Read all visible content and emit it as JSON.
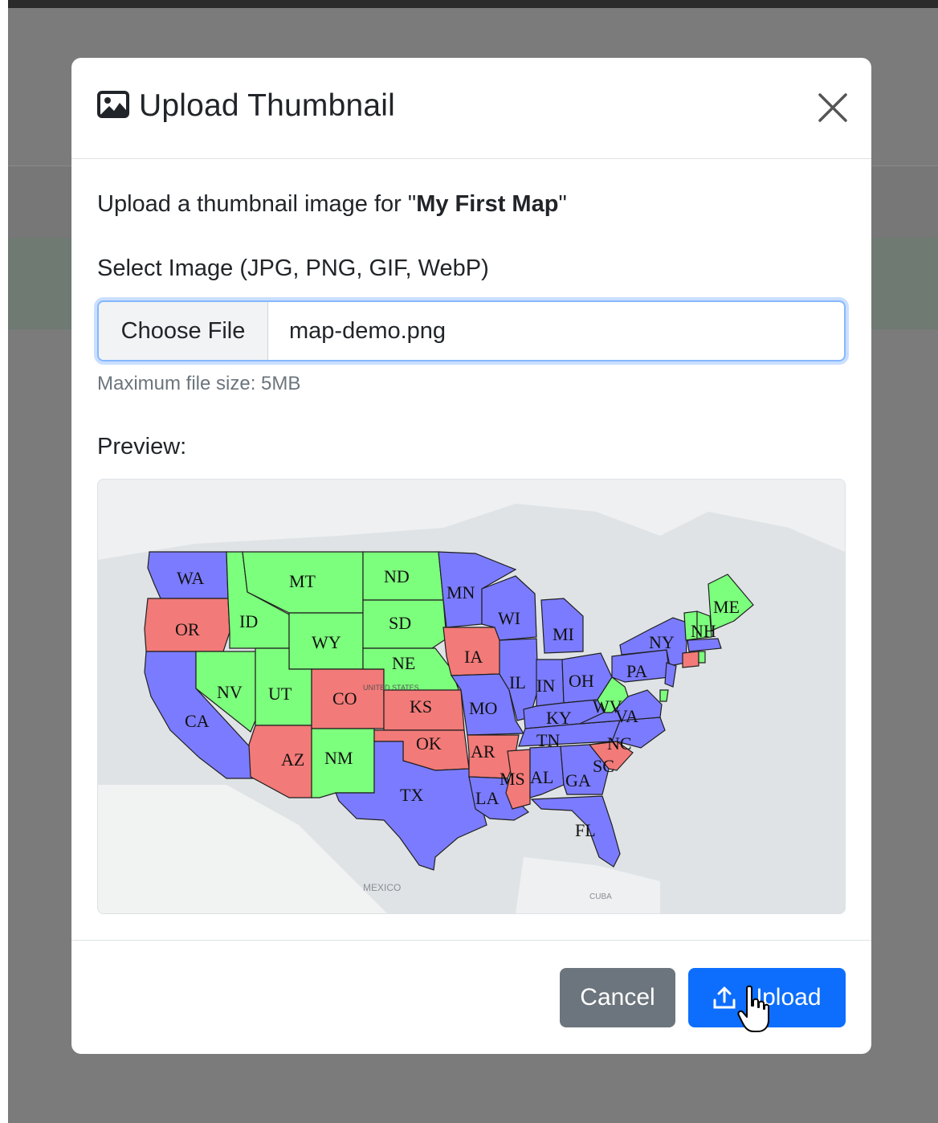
{
  "modal": {
    "title": "Upload Thumbnail",
    "close_icon": "close-icon",
    "description_prefix": "Upload a thumbnail image for \"",
    "map_name": "My First Map",
    "description_suffix": "\"",
    "select_label": "Select Image (JPG, PNG, GIF, WebP)",
    "choose_file_label": "Choose File",
    "file_name": "map-demo.png",
    "help_text": "Maximum file size: 5MB",
    "preview_label": "Preview:",
    "cancel_label": "Cancel",
    "upload_label": "Upload"
  },
  "preview_map": {
    "basemap_labels": [
      "MEXICO",
      "CUBA",
      "UNITED STATES"
    ],
    "states": {
      "green": [
        "MT",
        "ND",
        "SD",
        "ID",
        "WY",
        "NE",
        "NV",
        "UT",
        "NM",
        "WV",
        "ME",
        "NH"
      ],
      "red": [
        "OR",
        "CO",
        "KS",
        "IA",
        "AZ",
        "OK",
        "AR",
        "MS",
        "SC"
      ],
      "blue": [
        "WA",
        "CA",
        "MN",
        "WI",
        "MI",
        "IL",
        "IN",
        "OH",
        "MO",
        "KY",
        "TN",
        "AL",
        "GA",
        "FL",
        "LA",
        "TX",
        "NY",
        "PA",
        "VA",
        "NC"
      ]
    },
    "colors": {
      "green": "#7cff7c",
      "red": "#f27a78",
      "blue": "#7b7bff"
    }
  },
  "colors": {
    "primary": "#0d6efd",
    "secondary": "#6c757d",
    "overlay": "#7b7b7b"
  }
}
